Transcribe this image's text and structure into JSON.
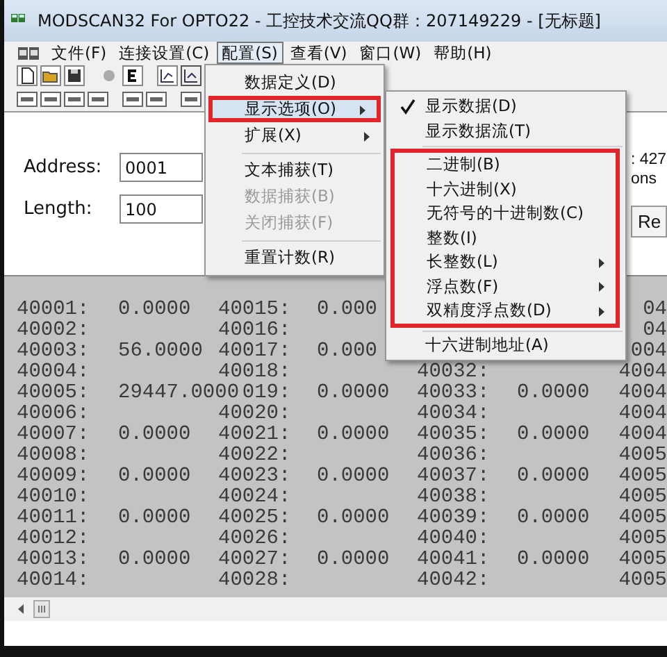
{
  "window": {
    "title": "MODSCAN32 For OPTO22 - 工控技术交流QQ群：207149229 - [无标题]"
  },
  "menu_bar": [
    {
      "label": "文件(F)",
      "selected": false
    },
    {
      "label": "连接设置(C)",
      "selected": false
    },
    {
      "label": "配置(S)",
      "selected": true
    },
    {
      "label": "查看(V)",
      "selected": false
    },
    {
      "label": "窗口(W)",
      "selected": false
    },
    {
      "label": "帮助(H)",
      "selected": false
    }
  ],
  "config_menu": {
    "items": [
      {
        "kind": "item",
        "label": "数据定义(D)",
        "selected": false,
        "disabled": false,
        "submenu": false,
        "annotated": false
      },
      {
        "kind": "item",
        "label": "显示选项(O)",
        "selected": true,
        "disabled": false,
        "submenu": true,
        "annotated": true
      },
      {
        "kind": "item",
        "label": "扩展(X)",
        "selected": false,
        "disabled": false,
        "submenu": true,
        "annotated": false
      },
      {
        "kind": "separator"
      },
      {
        "kind": "item",
        "label": "文本捕获(T)",
        "selected": false,
        "disabled": false,
        "submenu": false,
        "annotated": false
      },
      {
        "kind": "item",
        "label": "数据捕获(B)",
        "selected": false,
        "disabled": true,
        "submenu": false,
        "annotated": false
      },
      {
        "kind": "item",
        "label": "关闭捕获(F)",
        "selected": false,
        "disabled": true,
        "submenu": false,
        "annotated": false
      },
      {
        "kind": "separator"
      },
      {
        "kind": "item",
        "label": "重置计数(R)",
        "selected": false,
        "disabled": false,
        "submenu": false,
        "annotated": false
      }
    ]
  },
  "display_submenu": {
    "sections": [
      {
        "annotated": false,
        "items": [
          {
            "label": "显示数据(D)",
            "checked": true,
            "submenu": false
          },
          {
            "label": "显示数据流(T)",
            "checked": false,
            "submenu": false
          }
        ]
      },
      {
        "annotated": true,
        "items": [
          {
            "label": "二进制(B)",
            "checked": false,
            "submenu": false
          },
          {
            "label": "十六进制(X)",
            "checked": false,
            "submenu": false
          },
          {
            "label": "无符号的十进制数(C)",
            "checked": false,
            "submenu": false
          },
          {
            "label": "整数(I)",
            "checked": false,
            "submenu": false
          },
          {
            "label": "长整数(L)",
            "checked": false,
            "submenu": true
          },
          {
            "label": "浮点数(F)",
            "checked": false,
            "submenu": true
          },
          {
            "label": "双精度浮点数(D)",
            "checked": false,
            "submenu": true
          }
        ]
      },
      {
        "annotated": false,
        "items": [
          {
            "label": "十六进制地址(A)",
            "checked": false,
            "submenu": false
          }
        ]
      }
    ]
  },
  "form": {
    "fields": [
      {
        "label": "Address:",
        "value": "0001"
      },
      {
        "label": "Length:",
        "value": "100"
      }
    ],
    "right_texts": [
      ": 427",
      "ons"
    ],
    "right_button": "Re"
  },
  "data": {
    "rows": [
      {
        "group_1": {
          "address": "40001:",
          "value": "0.0000"
        },
        "group_2": {
          "address": "40015:",
          "value": "0.000"
        },
        "tail": "04"
      },
      {
        "group_1": {
          "address": "40002:"
        },
        "group_2": {
          "address": "40016:"
        },
        "tail": "04"
      },
      {
        "group_1": {
          "address": "40003:",
          "value": "56.0000"
        },
        "group_2": {
          "address": "40017:",
          "value": "0.000"
        },
        "tail": "004"
      },
      {
        "group_1": {
          "address": "40004:"
        },
        "group_2": {
          "address": "40018:"
        },
        "group_3": {
          "address": "40032:"
        },
        "tail": "4004"
      },
      {
        "group_1": {
          "address": "40005:",
          "value": "29447.0000"
        },
        "group_2": {
          "address": "019:",
          "value": "0.0000"
        },
        "group_3": {
          "address": "40033:",
          "value": "0.0000"
        },
        "tail": "4004"
      },
      {
        "group_1": {
          "address": "40006:"
        },
        "group_2": {
          "address": "40020:"
        },
        "group_3": {
          "address": "40034:"
        },
        "tail": "4004"
      },
      {
        "group_1": {
          "address": "40007:",
          "value": "0.0000"
        },
        "group_2": {
          "address": "40021:",
          "value": "0.0000"
        },
        "group_3": {
          "address": "40035:",
          "value": "0.0000"
        },
        "tail": "4004"
      },
      {
        "group_1": {
          "address": "40008:"
        },
        "group_2": {
          "address": "40022:"
        },
        "group_3": {
          "address": "40036:"
        },
        "tail": "4005"
      },
      {
        "group_1": {
          "address": "40009:",
          "value": "0.0000"
        },
        "group_2": {
          "address": "40023:",
          "value": "0.0000"
        },
        "group_3": {
          "address": "40037:",
          "value": "0.0000"
        },
        "tail": "4005"
      },
      {
        "group_1": {
          "address": "40010:"
        },
        "group_2": {
          "address": "40024:"
        },
        "group_3": {
          "address": "40038:"
        },
        "tail": "4005"
      },
      {
        "group_1": {
          "address": "40011:",
          "value": "0.0000"
        },
        "group_2": {
          "address": "40025:",
          "value": "0.0000"
        },
        "group_3": {
          "address": "40039:",
          "value": "0.0000"
        },
        "tail": "4005"
      },
      {
        "group_1": {
          "address": "40012:"
        },
        "group_2": {
          "address": "40026:"
        },
        "group_3": {
          "address": "40040:"
        },
        "tail": "4005"
      },
      {
        "group_1": {
          "address": "40013:",
          "value": "0.0000"
        },
        "group_2": {
          "address": "40027:",
          "value": "0.0000"
        },
        "group_3": {
          "address": "40041:",
          "value": "0.0000"
        },
        "tail": "4005"
      },
      {
        "group_1": {
          "address": "40014:"
        },
        "group_2": {
          "address": "40028:"
        },
        "group_3": {
          "address": "40042:"
        },
        "tail": "4005"
      }
    ]
  }
}
